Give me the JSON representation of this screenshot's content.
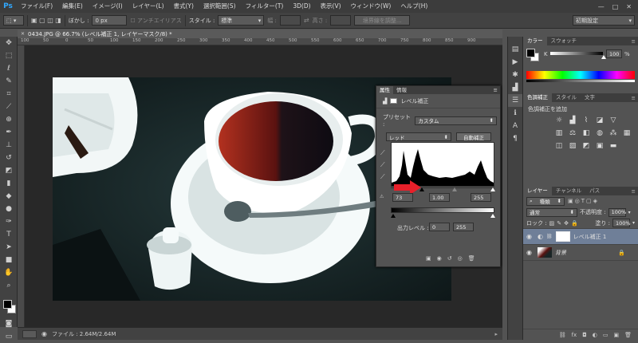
{
  "app": {
    "logo": "Ps"
  },
  "menu": [
    "ファイル(F)",
    "編集(E)",
    "イメージ(I)",
    "レイヤー(L)",
    "書式(Y)",
    "選択範囲(S)",
    "フィルター(T)",
    "3D(D)",
    "表示(V)",
    "ウィンドウ(W)",
    "ヘルプ(H)"
  ],
  "options": {
    "feather_label": "ぼかし :",
    "feather_value": "0 px",
    "antialias": "アンチエイリアス",
    "style_label": "スタイル :",
    "style_value": "標準",
    "width_label": "幅 :",
    "height_label": "高さ :",
    "refine_button": "境界線を調整...",
    "workspace": "初期設定"
  },
  "document": {
    "tab_title": "0434.JPG @ 66.7% (レベル補正 1, レイヤーマスク/8) *",
    "ruler_ticks": [
      "100",
      "50",
      "0",
      "50",
      "100",
      "150",
      "200",
      "250",
      "300",
      "350",
      "400",
      "450",
      "500",
      "550",
      "600",
      "650",
      "700",
      "750",
      "800",
      "850",
      "900"
    ],
    "status_file": "ファイル : 2.64M/2.64M"
  },
  "properties": {
    "tabs": [
      "属性",
      "情報"
    ],
    "title": "レベル補正",
    "preset_label": "プリセット :",
    "preset_value": "カスタム",
    "channel_value": "レッド",
    "auto_button": "自動補正",
    "input_black": "73",
    "input_gamma": "1.00",
    "input_white": "255",
    "output_label": "出力レベル :",
    "output_black": "0",
    "output_white": "255"
  },
  "color_panel": {
    "tabs": [
      "カラー",
      "スウォッチ"
    ],
    "channel": "K",
    "value": "100",
    "unit": "%"
  },
  "adjust_panel": {
    "tabs": [
      "色調補正",
      "スタイル",
      "文字"
    ],
    "title": "色調補正を追加"
  },
  "layers_panel": {
    "tabs": [
      "レイヤー",
      "チャンネル",
      "パス"
    ],
    "filter": "種類",
    "blend_mode": "通常",
    "opacity_label": "不透明度 :",
    "opacity_value": "100%",
    "lock_label": "ロック :",
    "fill_label": "塗り :",
    "fill_value": "100%",
    "layers": [
      {
        "name": "レベル補正 1"
      },
      {
        "name": "背景"
      }
    ]
  },
  "colors": {
    "accent": "#31a8ff",
    "arrow": "#e8202a"
  }
}
